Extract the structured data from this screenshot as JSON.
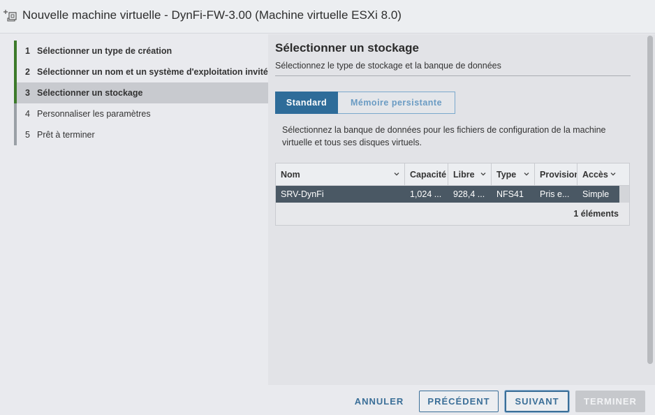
{
  "window": {
    "title": "Nouvelle machine virtuelle - DynFi-FW-3.00 (Machine virtuelle ESXi 8.0)",
    "icon": "new-vm-icon"
  },
  "steps": [
    {
      "num": "1",
      "label": "Sélectionner un type de création",
      "state": "done"
    },
    {
      "num": "2",
      "label": "Sélectionner un nom et un système d'exploitation invité",
      "state": "done"
    },
    {
      "num": "3",
      "label": "Sélectionner un stockage",
      "state": "active"
    },
    {
      "num": "4",
      "label": "Personnaliser les paramètres",
      "state": "pending"
    },
    {
      "num": "5",
      "label": "Prêt à terminer",
      "state": "pending"
    }
  ],
  "content": {
    "title": "Sélectionner un stockage",
    "subtitle": "Sélectionnez le type de stockage et la banque de données",
    "tabs": [
      {
        "label": "Standard",
        "selected": true
      },
      {
        "label": "Mémoire persistante",
        "selected": false
      }
    ],
    "description": "Sélectionnez la banque de données pour les fichiers de configuration de la machine virtuelle et tous ses disques virtuels."
  },
  "table": {
    "columns": [
      "Nom",
      "Capacité",
      "Libre",
      "Type",
      "Provisionnement",
      "Accès"
    ],
    "rows": [
      {
        "nom": "SRV-DynFi",
        "capacite": "1,024 ...",
        "libre": "928,4 ...",
        "type": "NFS41",
        "provisionnement": "Pris e...",
        "acces": "Simple",
        "selected": true
      }
    ],
    "count_label": "1 éléments"
  },
  "footer": {
    "cancel": "ANNULER",
    "previous": "PRÉCÉDENT",
    "next": "SUIVANT",
    "finish": "TERMINER"
  },
  "colors": {
    "accent": "#2e6c99",
    "step_done": "#3c7a2a",
    "row_selected": "#4a5864"
  }
}
